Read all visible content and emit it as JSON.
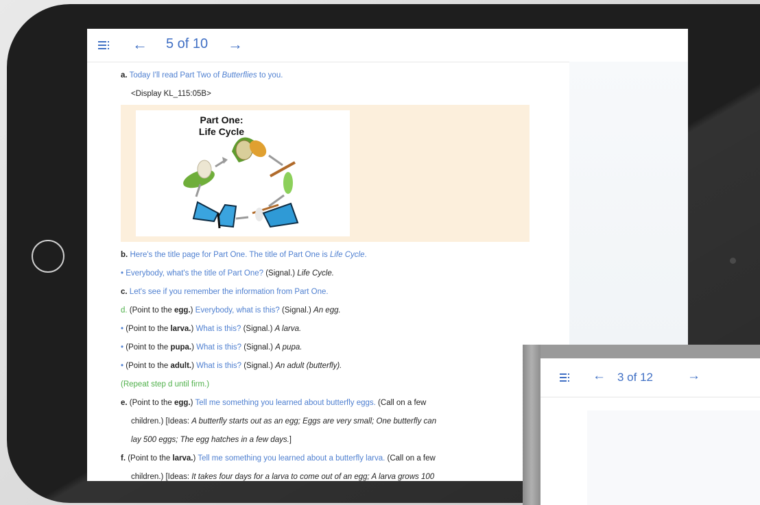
{
  "colors": {
    "accent": "#3f6fc4",
    "teacher_speech": "#4e7fd0",
    "correction": "#4fb04a",
    "display_bg": "#fcefdc",
    "bezel": "#1e1e1e"
  },
  "tablet": {
    "toolbar": {
      "menu_icon": "hamburger-menu-icon",
      "prev": "←",
      "page": "5 of 10",
      "next": "→"
    },
    "lesson": {
      "a_marker": "a.",
      "a_text": "Today I'll read Part Two of ",
      "a_title": "Butterflies",
      "a_end": " to you.",
      "display_ref": "<Display KL_115:05B>",
      "figure": {
        "title_line1": "Part One:",
        "title_line2": "Life Cycle"
      },
      "b_marker": "b.",
      "b_text": "Here's the title page for Part One. The title of Part One is ",
      "b_title": "Life Cycle",
      "b_end": ".",
      "b2_bullet": "•",
      "b2_text": "Everybody, what's the title of Part One?",
      "b2_signal": " (Signal.) ",
      "b2_answer": "Life Cycle.",
      "c_marker": "c.",
      "c_text": "Let's see if you remember the information from Part One.",
      "d_marker": "d.",
      "d_point_pre": " (Point to the ",
      "d_point_word": "egg.",
      "d_point_post": ")",
      "d_q": " Everybody, what is this?",
      "d_signal": " (Signal.) ",
      "d_answer": "An egg.",
      "d2_point_pre": "(Point to the ",
      "d2_word": "larva.",
      "d2_point_post": ")",
      "d2_q": " What is this?",
      "d2_signal": " (Signal.) ",
      "d2_answer": "A larva.",
      "d3_point_pre": "(Point to the ",
      "d3_word": "pupa.",
      "d3_point_post": ")",
      "d3_q": " What is this?",
      "d3_signal": " (Signal.) ",
      "d3_answer": "A pupa.",
      "d4_point_pre": "(Point to the ",
      "d4_word": "adult.",
      "d4_point_post": ")",
      "d4_q": " What is this?",
      "d4_signal": " (Signal.) ",
      "d4_answer": "An adult (butterfly).",
      "repeat": "(Repeat step d until firm.)",
      "e_marker": "e.",
      "e_point_pre": " (Point to the ",
      "e_word": "egg.",
      "e_point_post": ")",
      "e_q": " Tell me something you learned about butterfly eggs.",
      "e_call": " (Call on a few",
      "e2_pre": "children.) [Ideas: ",
      "e2_ideas": "A butterfly starts out as an egg; Eggs are very small; One butterfly can",
      "e3_ideas": "lay 500 eggs; The egg hatches in a few days.",
      "e3_end": "]",
      "f_marker": "f.",
      "f_point_pre": " (Point to the ",
      "f_word": "larva.",
      "f_point_post": ")",
      "f_q": " Tell me something you learned about a butterfly larva.",
      "f_call": " (Call on a few",
      "f2_pre": "children.) [Ideas: ",
      "f2_ideas": "It takes four days for a larva to come out of an egg; A larva grows 100"
    }
  },
  "phone": {
    "toolbar": {
      "menu_icon": "hamburger-menu-icon",
      "prev": "←",
      "page": "3 of 12",
      "next": "→"
    }
  }
}
